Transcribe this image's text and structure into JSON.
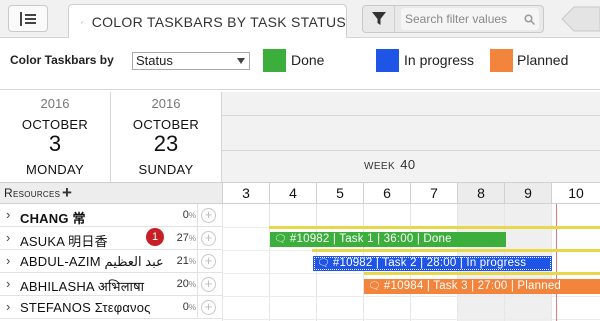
{
  "toolbar": {
    "active_tab_label": "COLOR TASKBARS BY TASK STATUS",
    "filter_placeholder": "Search filter values"
  },
  "color_taskbars": {
    "label": "Color Taskbars by",
    "selected": "Status",
    "legend": [
      {
        "label": "Done",
        "color": "#3bae3b"
      },
      {
        "label": "In progress",
        "color": "#1f55e6"
      },
      {
        "label": "Planned",
        "color": "#f3843c"
      }
    ]
  },
  "dates": [
    {
      "year": "2016",
      "month": "OCTOBER",
      "day": "3",
      "weekday": "MONDAY"
    },
    {
      "year": "2016",
      "month": "OCTOBER",
      "day": "23",
      "weekday": "SUNDAY"
    }
  ],
  "week": {
    "label": "WEEK",
    "number": "40"
  },
  "resources_header": "Resources",
  "days": [
    "3",
    "4",
    "5",
    "6",
    "7",
    "8",
    "9",
    "10"
  ],
  "resources": [
    {
      "name": "CHANG 常",
      "pct": "0",
      "bold": true
    },
    {
      "name": "ASUKA 明日香",
      "pct": "27",
      "badge": "1"
    },
    {
      "name": "ABDUL-AZIM عبد العظيم",
      "pct": "21"
    },
    {
      "name": "ABHILASHA अभिलाषा",
      "pct": "20"
    },
    {
      "name": "STEFANOS Στεφανος",
      "pct": "0"
    }
  ],
  "pct_symbol": "%",
  "tasks": [
    {
      "label": "#10982 | Task 1 | 36:00 | Done",
      "status": "Done"
    },
    {
      "label": "#10982 | Task 2 | 28:00 | In progress",
      "status": "In progress"
    },
    {
      "label": "#10984 | Task 3 | 27:00 | Planned",
      "status": "Planned"
    }
  ],
  "icons": [
    "list-icon",
    "brush-icon",
    "filter-icon",
    "magnifier-icon",
    "chevron-right-icon",
    "plus-icon",
    "comment-icon"
  ]
}
